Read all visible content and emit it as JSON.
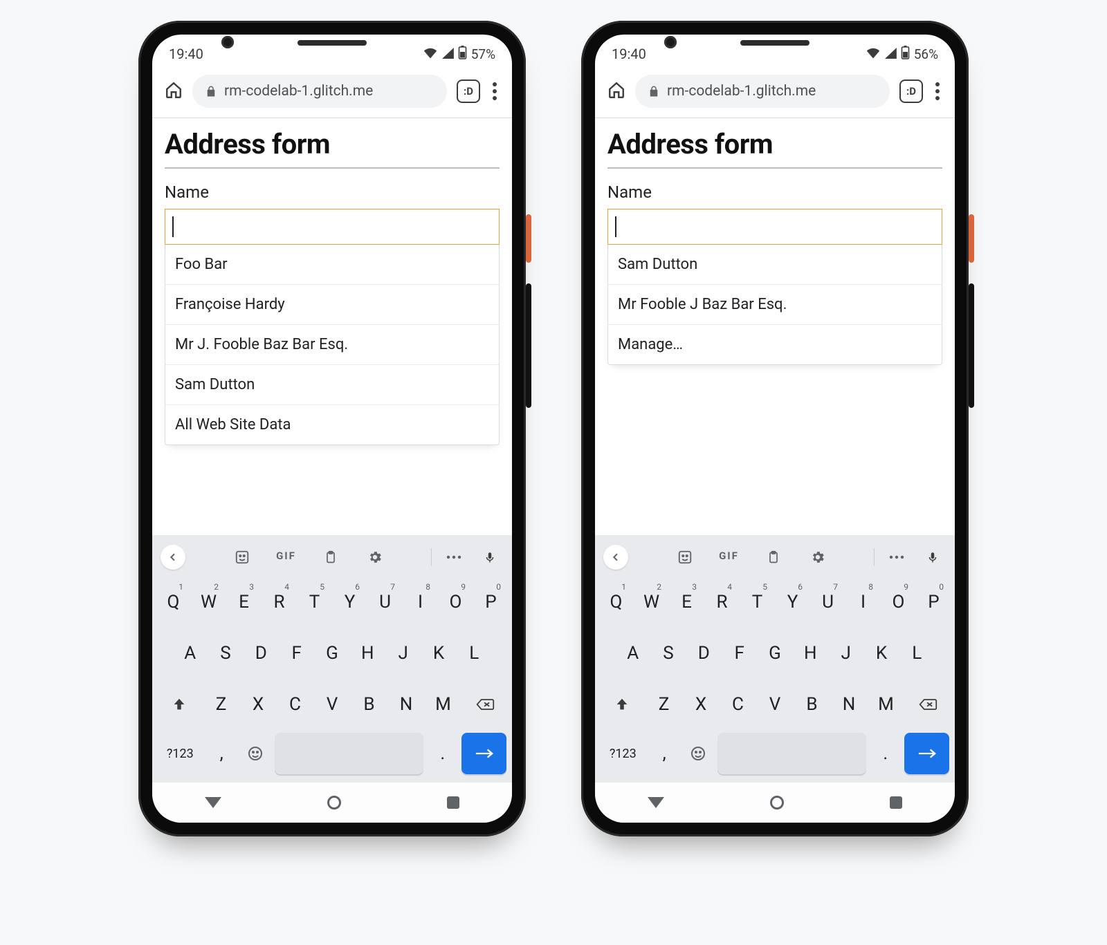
{
  "phones": [
    {
      "status": {
        "time": "19:40",
        "battery": "57%"
      },
      "browser": {
        "url": "rm-codelab-1.glitch.me",
        "tab_label": ":D"
      },
      "page": {
        "title": "Address form",
        "field_label": "Name",
        "input_value": "",
        "suggestions": [
          "Foo Bar",
          "Françoise Hardy",
          "Mr J. Fooble Baz Bar Esq.",
          "Sam Dutton",
          "All Web Site Data"
        ]
      }
    },
    {
      "status": {
        "time": "19:40",
        "battery": "56%"
      },
      "browser": {
        "url": "rm-codelab-1.glitch.me",
        "tab_label": ":D"
      },
      "page": {
        "title": "Address form",
        "field_label": "Name",
        "input_value": "",
        "suggestions": [
          "Sam Dutton",
          "Mr Fooble J Baz Bar Esq.",
          "Manage…"
        ]
      }
    }
  ],
  "keyboard": {
    "toolbar": {
      "gif": "GIF"
    },
    "row1": [
      {
        "k": "Q",
        "s": "1"
      },
      {
        "k": "W",
        "s": "2"
      },
      {
        "k": "E",
        "s": "3"
      },
      {
        "k": "R",
        "s": "4"
      },
      {
        "k": "T",
        "s": "5"
      },
      {
        "k": "Y",
        "s": "6"
      },
      {
        "k": "U",
        "s": "7"
      },
      {
        "k": "I",
        "s": "8"
      },
      {
        "k": "O",
        "s": "9"
      },
      {
        "k": "P",
        "s": "0"
      }
    ],
    "row2": [
      "A",
      "S",
      "D",
      "F",
      "G",
      "H",
      "J",
      "K",
      "L"
    ],
    "row3": [
      "Z",
      "X",
      "C",
      "V",
      "B",
      "N",
      "M"
    ],
    "bottom": {
      "sym": "?123",
      "comma": ",",
      "period": "."
    }
  }
}
